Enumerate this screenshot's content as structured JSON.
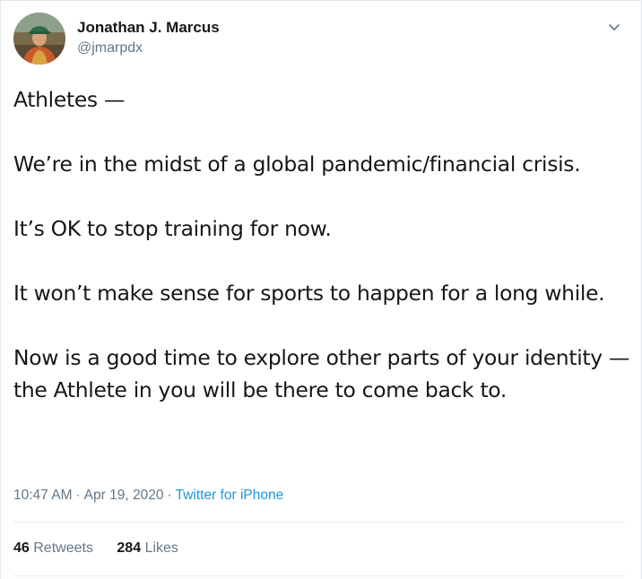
{
  "author": {
    "name": "Jonathan J. Marcus",
    "handle": "@jmarpdx",
    "avatar_icon": "person-photo-avatar"
  },
  "tweet": {
    "paragraphs": [
      "Athletes —",
      "We’re in the midst of a global pandemic/financial crisis.",
      "It’s OK to stop training for now.",
      "It won’t make sense for sports to happen for a long while.",
      "Now is a good time to explore other parts of your identity — the Athlete in you will be there to come back to."
    ],
    "time": "10:47 AM",
    "date": "Apr 19, 2020",
    "separator": "·",
    "source": "Twitter for iPhone"
  },
  "stats": {
    "retweets_count": "46",
    "retweets_label": "Retweets",
    "likes_count": "284",
    "likes_label": "Likes"
  },
  "icons": {
    "menu": "chevron-down-icon"
  },
  "colors": {
    "text": "#14171a",
    "secondary": "#657786",
    "link": "#1b95e0",
    "divider": "#e6ecf0"
  }
}
